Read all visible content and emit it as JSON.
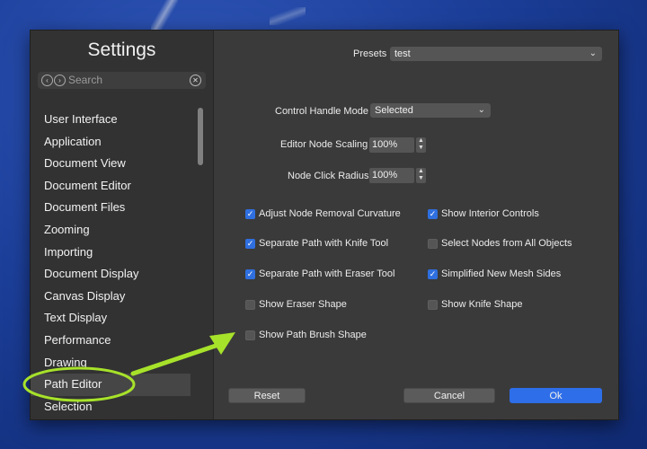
{
  "sidebar": {
    "title": "Settings",
    "search_placeholder": "Search",
    "items": [
      {
        "label": "User Interface"
      },
      {
        "label": "Application"
      },
      {
        "label": "Document View"
      },
      {
        "label": "Document Editor"
      },
      {
        "label": "Document Files"
      },
      {
        "label": "Zooming"
      },
      {
        "label": "Importing"
      },
      {
        "label": "Document Display"
      },
      {
        "label": "Canvas Display"
      },
      {
        "label": "Text Display"
      },
      {
        "label": "Performance"
      },
      {
        "label": "Drawing"
      },
      {
        "label": "Path Editor",
        "selected": true
      },
      {
        "label": "Selection"
      }
    ]
  },
  "presets": {
    "label": "Presets",
    "value": "test"
  },
  "control_handle_mode": {
    "label": "Control Handle Mode",
    "value": "Selected"
  },
  "editor_node_scaling": {
    "label": "Editor Node Scaling",
    "value": "100%"
  },
  "node_click_radius": {
    "label": "Node Click Radius",
    "value": "100%"
  },
  "checkboxes": {
    "adjust_node_removal": {
      "label": "Adjust Node Removal Curvature",
      "checked": true
    },
    "separate_knife": {
      "label": "Separate Path with Knife Tool",
      "checked": true
    },
    "separate_eraser": {
      "label": "Separate Path with Eraser Tool",
      "checked": true
    },
    "show_eraser_shape": {
      "label": "Show Eraser Shape",
      "checked": false
    },
    "show_path_brush_shape": {
      "label": "Show Path Brush Shape",
      "checked": false
    },
    "show_interior_controls": {
      "label": "Show Interior Controls",
      "checked": true
    },
    "select_nodes_all": {
      "label": "Select Nodes from All Objects",
      "checked": false
    },
    "simplified_mesh": {
      "label": "Simplified New Mesh Sides",
      "checked": true
    },
    "show_knife_shape": {
      "label": "Show Knife Shape",
      "checked": false
    }
  },
  "buttons": {
    "reset": "Reset",
    "cancel": "Cancel",
    "ok": "Ok"
  },
  "colors": {
    "accent": "#2e6ee8",
    "annotation": "#a7e22a",
    "window_bg": "#3a3a3a"
  },
  "icons": {
    "back": "chevron-left-icon",
    "forward": "chevron-right-icon",
    "clear": "clear-icon",
    "dropdown": "chevron-down-icon",
    "stepper": "stepper-icon",
    "check": "checkmark-icon"
  }
}
